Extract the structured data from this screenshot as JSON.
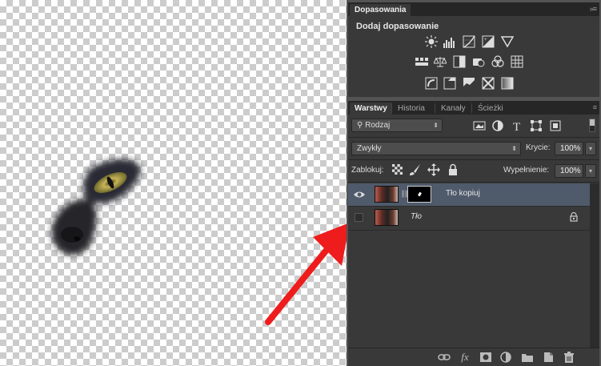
{
  "adjustments": {
    "tab_label": "Dopasowania",
    "title": "Dodaj dopasowanie",
    "icons": [
      "brightness-contrast-icon",
      "levels-icon",
      "curves-icon",
      "exposure-icon",
      "vibrance-icon",
      "hue-saturation-icon",
      "color-balance-icon",
      "black-white-icon",
      "photo-filter-icon",
      "channel-mixer-icon",
      "color-lookup-icon",
      "invert-icon",
      "posterize-icon",
      "threshold-icon",
      "selective-color-icon",
      "gradient-map-icon"
    ]
  },
  "layers": {
    "tabs": [
      "Warstwy",
      "Historia",
      "Kanały",
      "Ścieżki"
    ],
    "filter_label": "Rodzaj",
    "blend_mode": "Zwykły",
    "opacity_label": "Krycie:",
    "opacity_value": "100%",
    "lock_label": "Zablokuj:",
    "fill_label": "Wypełnienie:",
    "fill_value": "100%",
    "items": [
      {
        "name": "Tło kopiuj",
        "visible": true,
        "selected": true,
        "has_mask": true
      },
      {
        "name": "Tło",
        "visible": false,
        "selected": false,
        "locked": true
      }
    ],
    "footer_fx": "fx"
  },
  "colors": {
    "arrow": "#ee1c1c",
    "selected_row": "#4f5a6b",
    "panel": "#393939"
  }
}
